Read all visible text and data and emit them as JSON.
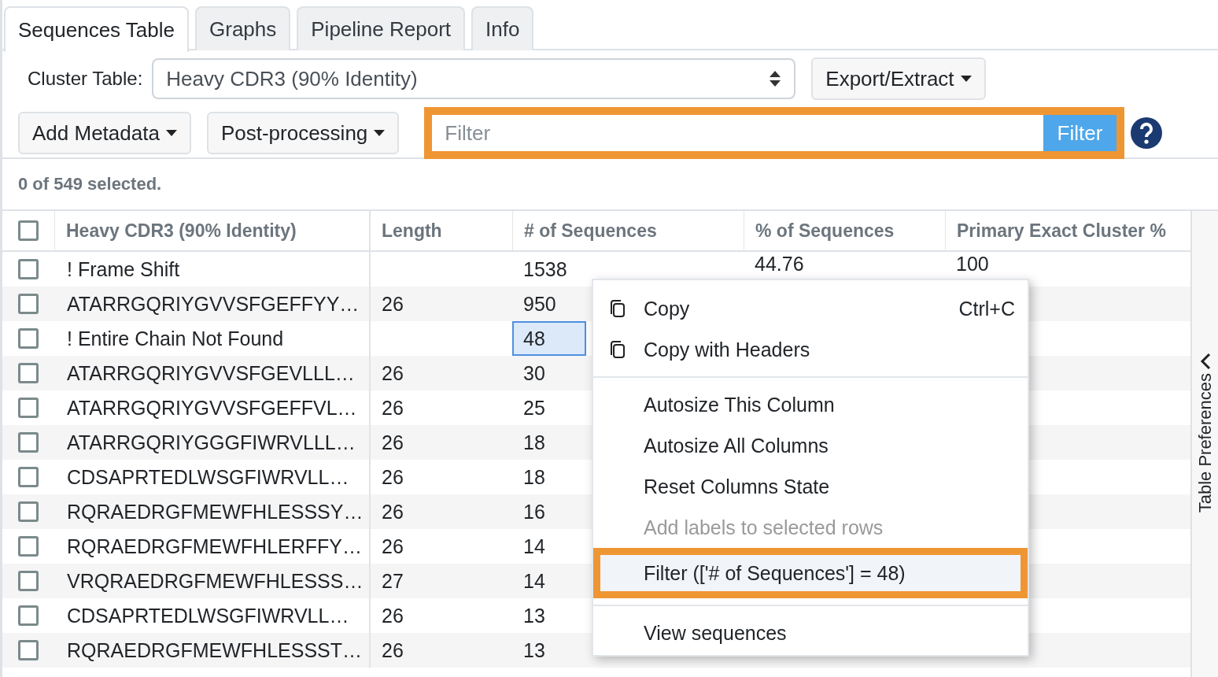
{
  "tabs": [
    {
      "label": "Sequences Table",
      "selected": true
    },
    {
      "label": "Graphs",
      "selected": false
    },
    {
      "label": "Pipeline Report",
      "selected": false
    },
    {
      "label": "Info",
      "selected": false
    }
  ],
  "cluster_table": {
    "label": "Cluster Table:",
    "value": "Heavy CDR3 (90% Identity)"
  },
  "export_button": "Export/Extract",
  "toolbar_buttons": [
    "Add Metadata",
    "Post-processing"
  ],
  "filter": {
    "placeholder": "Filter",
    "button": "Filter",
    "highlighted": true
  },
  "selection_status": "0 of 549 selected.",
  "table": {
    "all_checked": false,
    "columns": [
      "Heavy CDR3 (90% Identity)",
      "Length",
      "# of Sequences",
      "% of Sequences",
      "Primary Exact Cluster %"
    ],
    "rows": [
      {
        "checked": false,
        "cells": [
          "! Frame Shift",
          "",
          "1538",
          "44.76",
          "100"
        ],
        "focused_cell": false
      },
      {
        "checked": false,
        "cells": [
          "ATARRGQRIYGVVSFGEFFYY…",
          "26",
          "950"
        ],
        "focused_cell": false
      },
      {
        "checked": false,
        "cells": [
          "! Entire Chain Not Found",
          "",
          "48"
        ],
        "focused_cell": true
      },
      {
        "checked": false,
        "cells": [
          "ATARRGQRIYGVVSFGEVLLL…",
          "26",
          "30"
        ],
        "focused_cell": false
      },
      {
        "checked": false,
        "cells": [
          "ATARRGQRIYGVVSFGEFFVL…",
          "26",
          "25"
        ],
        "focused_cell": false
      },
      {
        "checked": false,
        "cells": [
          "ATARRGQRIYGGGFIWRVLLL…",
          "26",
          "18"
        ],
        "focused_cell": false
      },
      {
        "checked": false,
        "cells": [
          "CDSAPRTEDLWSGFIWRVLL…",
          "26",
          "18"
        ],
        "focused_cell": false
      },
      {
        "checked": false,
        "cells": [
          "RQRAEDRGFMEWFHLESSSY…",
          "26",
          "16"
        ],
        "focused_cell": false
      },
      {
        "checked": false,
        "cells": [
          "RQRAEDRGFMEWFHLERFFY…",
          "26",
          "14"
        ],
        "focused_cell": false
      },
      {
        "checked": false,
        "cells": [
          "VRQRAEDRGFMEWFHLESSS…",
          "27",
          "14"
        ],
        "focused_cell": false
      },
      {
        "checked": false,
        "cells": [
          "CDSAPRTEDLWSGFIWRVLL…",
          "26",
          "13"
        ],
        "focused_cell": false
      },
      {
        "checked": false,
        "cells": [
          "RQRAEDRGFMEWFHLESSST…",
          "26",
          "13"
        ],
        "focused_cell": false
      }
    ]
  },
  "side_panel": {
    "label": "Table Preferences"
  },
  "context_menu": [
    {
      "kind": "item",
      "label": "Copy",
      "icon": true,
      "shortcut": "Ctrl+C",
      "disabled": false,
      "highlighted": false
    },
    {
      "kind": "item",
      "label": "Copy with Headers",
      "icon": true,
      "disabled": false,
      "highlighted": false
    },
    {
      "kind": "separator"
    },
    {
      "kind": "item",
      "label": "Autosize This Column",
      "icon": false,
      "disabled": false,
      "highlighted": false
    },
    {
      "kind": "item",
      "label": "Autosize All Columns",
      "icon": false,
      "disabled": false,
      "highlighted": false
    },
    {
      "kind": "item",
      "label": "Reset Columns State",
      "icon": false,
      "disabled": false,
      "highlighted": false
    },
    {
      "kind": "item",
      "label": "Add labels to selected rows",
      "icon": false,
      "disabled": true,
      "highlighted": false
    },
    {
      "kind": "item",
      "label": "Filter (['# of Sequences'] = 48)",
      "icon": false,
      "disabled": false,
      "highlighted": true
    },
    {
      "kind": "separator"
    },
    {
      "kind": "item",
      "label": "View sequences",
      "icon": false,
      "disabled": false,
      "highlighted": false
    }
  ]
}
